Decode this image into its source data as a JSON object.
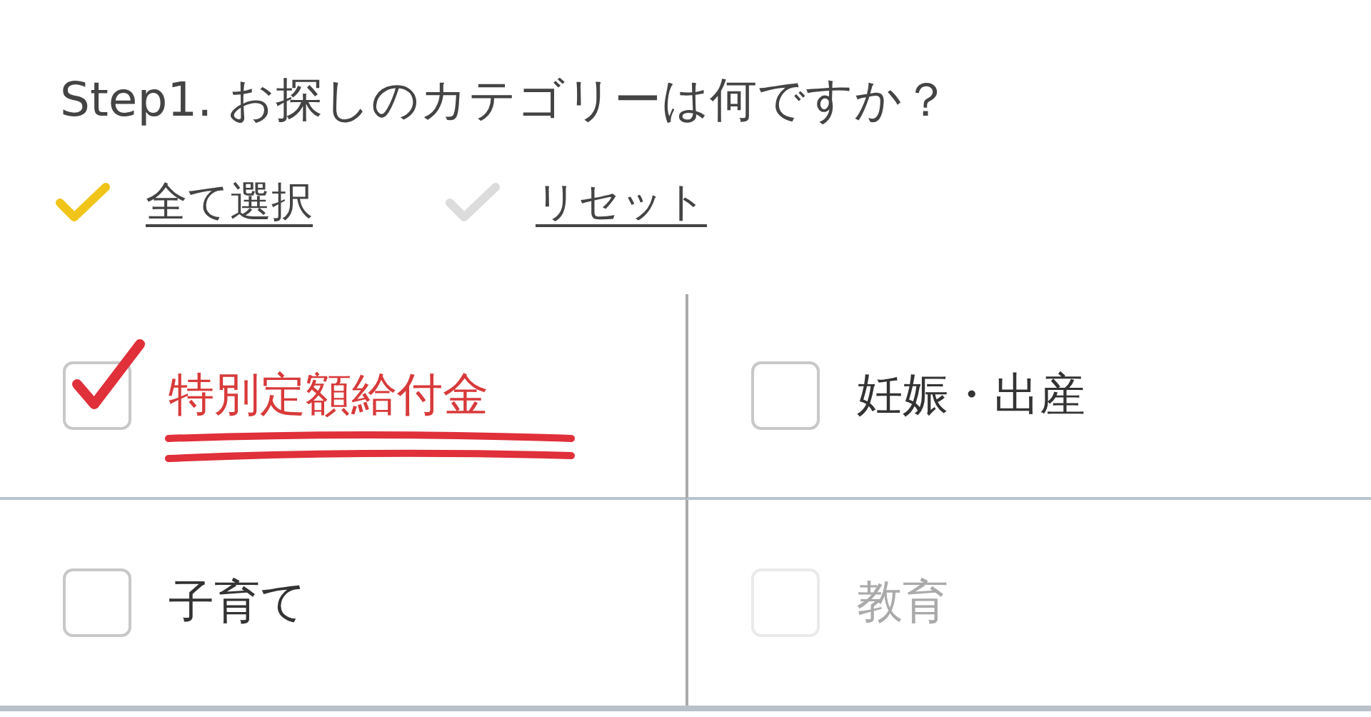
{
  "title": "Step1. お探しのカテゴリーは何ですか？",
  "actions": [
    {
      "label": "全て選択",
      "kind": "select-all"
    },
    {
      "label": "リセット",
      "kind": "reset"
    }
  ],
  "categories": [
    {
      "label": "特別定額給付金",
      "checked": true,
      "highlighted": true,
      "disabled": false
    },
    {
      "label": "妊娠・出産",
      "checked": false,
      "highlighted": false,
      "disabled": false
    },
    {
      "label": "子育て",
      "checked": false,
      "highlighted": false,
      "disabled": false
    },
    {
      "label": "教育",
      "checked": false,
      "highlighted": false,
      "disabled": true
    }
  ]
}
